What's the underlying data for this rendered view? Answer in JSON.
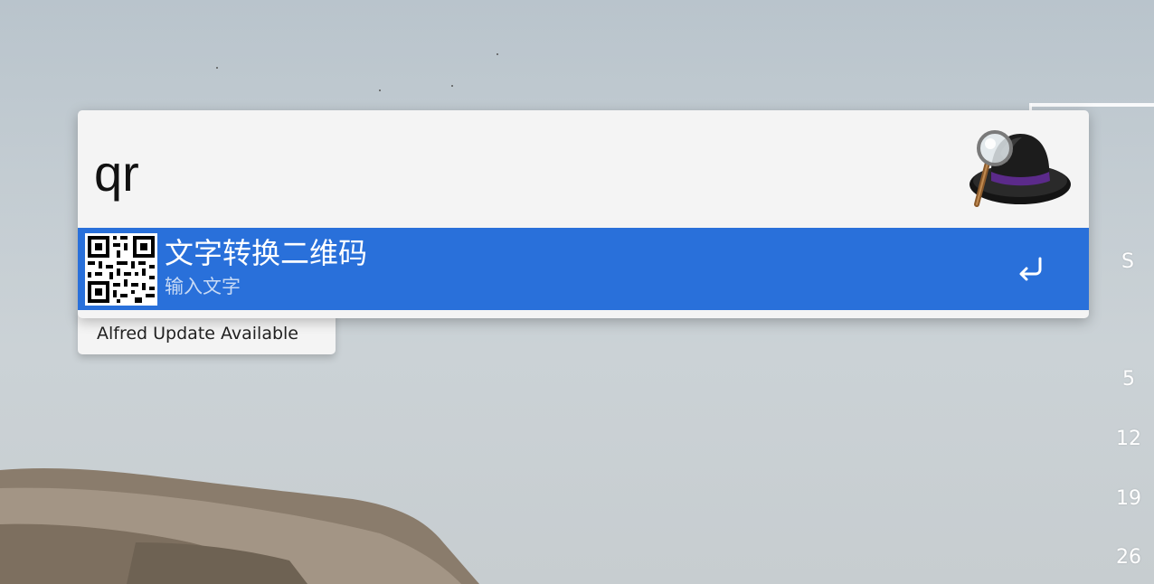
{
  "search": {
    "query": "qr"
  },
  "result": {
    "title": "文字转换二维码",
    "subtitle": "输入文字",
    "icon": "qr-code-icon",
    "action_icon": "return-icon"
  },
  "footer": {
    "update_label": "Alfred Update Available"
  },
  "app": {
    "logo_icon": "alfred-hat-icon"
  },
  "calendar": {
    "day_header": "S",
    "dates": [
      "5",
      "12",
      "19",
      "26"
    ]
  },
  "colors": {
    "selection": "#2970da",
    "window_bg": "#f4f4f4",
    "subtitle_text": "#c8daf5"
  }
}
